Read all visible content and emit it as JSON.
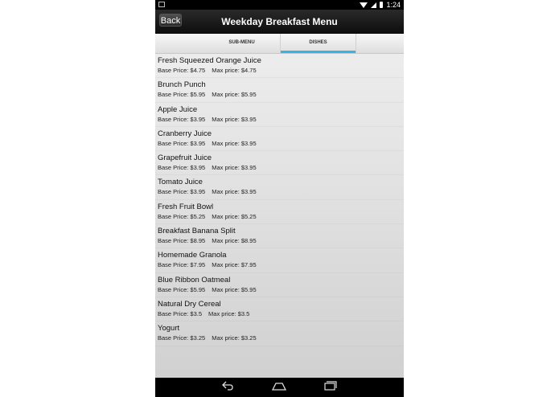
{
  "status": {
    "time": "1:24"
  },
  "header": {
    "back_label": "Back",
    "title": "Weekday Breakfast Menu"
  },
  "tabs": [
    {
      "label": "SUB-MENU",
      "selected": false
    },
    {
      "label": "DISHES",
      "selected": true
    }
  ],
  "accent_color": "#33b5e5",
  "price_labels": {
    "base": "Base Price:",
    "max": "Max price:"
  },
  "dishes": [
    {
      "name": "Fresh Squeezed Orange Juice",
      "base": "Base Price: $4.75",
      "max": "Max price: $4.75"
    },
    {
      "name": "Brunch Punch",
      "base": "Base Price: $5.95",
      "max": "Max price: $5.95"
    },
    {
      "name": "Apple Juice",
      "base": "Base Price: $3.95",
      "max": "Max price: $3.95"
    },
    {
      "name": "Cranberry Juice",
      "base": "Base Price: $3.95",
      "max": "Max price: $3.95"
    },
    {
      "name": "Grapefruit Juice",
      "base": "Base Price: $3.95",
      "max": "Max price: $3.95"
    },
    {
      "name": "Tomato Juice",
      "base": "Base Price: $3.95",
      "max": "Max price: $3.95"
    },
    {
      "name": "Fresh Fruit Bowl",
      "base": "Base Price: $5.25",
      "max": "Max price: $5.25"
    },
    {
      "name": "Breakfast Banana Split",
      "base": "Base Price: $8.95",
      "max": "Max price: $8.95"
    },
    {
      "name": "Homemade Granola",
      "base": "Base Price: $7.95",
      "max": "Max price: $7.95"
    },
    {
      "name": "Blue Ribbon Oatmeal",
      "base": "Base Price: $5.95",
      "max": "Max price: $5.95"
    },
    {
      "name": "Natural Dry Cereal",
      "base": "Base Price: $3.5",
      "max": "Max price: $3.5"
    },
    {
      "name": "Yogurt",
      "base": "Base Price: $3.25",
      "max": "Max price: $3.25"
    }
  ],
  "navbar": {
    "back_icon": "nav-back-icon",
    "home_icon": "nav-home-icon",
    "recents_icon": "nav-recents-icon"
  }
}
